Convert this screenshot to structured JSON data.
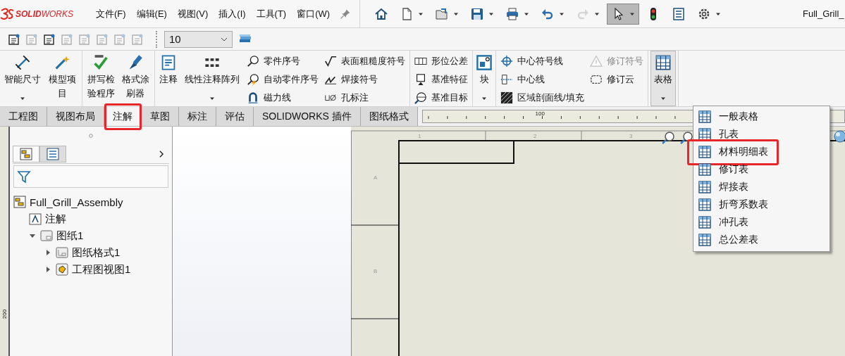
{
  "logo": {
    "text": "**SOLID**WORKS"
  },
  "menu_bar": [
    "文件(F)",
    "编辑(E)",
    "视图(V)",
    "插入(I)",
    "工具(T)",
    "窗口(W)"
  ],
  "quick_access": [
    {
      "has_dropdown": false,
      "disabled": false,
      "selected": false
    },
    {
      "has_dropdown": true,
      "disabled": false,
      "selected": false
    },
    {
      "has_dropdown": true,
      "disabled": false,
      "selected": false
    },
    {
      "has_dropdown": true,
      "disabled": false,
      "selected": false
    },
    {
      "has_dropdown": true,
      "disabled": false,
      "selected": false
    },
    {
      "has_dropdown": true,
      "disabled": false,
      "selected": false
    },
    {
      "has_dropdown": true,
      "disabled": true,
      "selected": false
    },
    {
      "has_dropdown": true,
      "disabled": false,
      "selected": true
    },
    {
      "has_dropdown": false,
      "disabled": false,
      "selected": false
    },
    {
      "has_dropdown": false,
      "disabled": false,
      "selected": false
    },
    {
      "has_dropdown": true,
      "disabled": false,
      "selected": false
    }
  ],
  "document_title": "Full_Grill_",
  "format_toolbar": {
    "tools": [
      {
        "disabled": false
      },
      {
        "disabled": true
      },
      {
        "disabled": false
      },
      {
        "disabled": true
      },
      {
        "disabled": true
      },
      {
        "disabled": true
      },
      {
        "disabled": true
      },
      {
        "disabled": true
      }
    ],
    "font_size": "10"
  },
  "ribbon": {
    "groups": [
      {
        "items": [
          {
            "kind": "large",
            "label": "智能尺寸",
            "has_dropdown": true,
            "selected": false
          },
          {
            "kind": "large",
            "label": "模型项目",
            "has_dropdown": false,
            "selected": false
          }
        ]
      },
      {
        "items": [
          {
            "kind": "large",
            "label": "拼写检验程序",
            "has_dropdown": false,
            "selected": false
          },
          {
            "kind": "large",
            "label": "格式涂刷器",
            "has_dropdown": false,
            "selected": false
          }
        ]
      },
      {
        "items": [
          {
            "kind": "large",
            "label": "注释",
            "has_dropdown": false,
            "selected": false
          },
          {
            "kind": "large",
            "label": "线性注释阵列",
            "has_dropdown": true,
            "selected": false
          },
          {
            "kind": "column",
            "entries": [
              {
                "label": "零件序号",
                "disabled": false
              },
              {
                "label": "自动零件序号",
                "disabled": false
              },
              {
                "label": "磁力线",
                "disabled": false
              }
            ]
          },
          {
            "kind": "column",
            "entries": [
              {
                "label": "表面粗糙度符号",
                "disabled": false
              },
              {
                "label": "焊接符号",
                "disabled": false
              },
              {
                "label": "孔标注",
                "disabled": false
              }
            ]
          }
        ]
      },
      {
        "items": [
          {
            "kind": "column",
            "entries": [
              {
                "label": "形位公差",
                "disabled": false
              },
              {
                "label": "基准特征",
                "disabled": false
              },
              {
                "label": "基准目标",
                "disabled": false
              }
            ]
          }
        ]
      },
      {
        "items": [
          {
            "kind": "large",
            "label": "块",
            "has_dropdown": true,
            "selected": false
          }
        ]
      },
      {
        "items": [
          {
            "kind": "column",
            "entries": [
              {
                "label": "中心符号线",
                "disabled": false
              },
              {
                "label": "中心线",
                "disabled": false
              },
              {
                "label": "区域剖面线/填充",
                "disabled": false
              }
            ]
          },
          {
            "kind": "column",
            "entries": [
              {
                "label": "修订符号",
                "disabled": true
              },
              {
                "label": "修订云",
                "disabled": false
              }
            ]
          }
        ]
      },
      {
        "items": [
          {
            "kind": "large",
            "label": "表格",
            "has_dropdown": true,
            "selected": true
          }
        ]
      }
    ]
  },
  "tabs": [
    {
      "label": "工程图",
      "selected": false,
      "highlighted": false
    },
    {
      "label": "视图布局",
      "selected": false,
      "highlighted": false
    },
    {
      "label": "注解",
      "selected": true,
      "highlighted": true
    },
    {
      "label": "草图",
      "selected": false,
      "highlighted": false
    },
    {
      "label": "标注",
      "selected": false,
      "highlighted": false
    },
    {
      "label": "评估",
      "selected": false,
      "highlighted": false
    },
    {
      "label": "SOLIDWORKS 插件",
      "selected": false,
      "highlighted": false
    },
    {
      "label": "图纸格式",
      "selected": false,
      "highlighted": false
    }
  ],
  "ruler": {
    "label": "100"
  },
  "side_ruler": {
    "label": "200"
  },
  "feature_manager": {
    "panel_tabs": [
      {
        "selected": true
      },
      {
        "selected": false
      }
    ],
    "tree": [
      {
        "label": "Full_Grill_Assembly",
        "children": [
          {
            "label": "注解"
          },
          {
            "label": "图纸1",
            "expanded": true,
            "children": [
              {
                "label": "图纸格式1",
                "expanded": false
              },
              {
                "label": "工程图视图1",
                "expanded": false
              }
            ]
          }
        ]
      }
    ]
  },
  "sheet": {
    "column_zones": [
      "1",
      "2",
      "3"
    ],
    "row_zones": [
      "A",
      "B"
    ]
  },
  "table_menu": {
    "items": [
      {
        "label": "一般表格",
        "highlighted": false
      },
      {
        "label": "孔表",
        "highlighted": false
      },
      {
        "label": "材料明细表",
        "highlighted": true
      },
      {
        "label": "修订表",
        "highlighted": false
      },
      {
        "label": "焊接表",
        "highlighted": false
      },
      {
        "label": "折弯系数表",
        "highlighted": false
      },
      {
        "label": "冲孔表",
        "highlighted": false
      },
      {
        "label": "总公差表",
        "highlighted": false
      }
    ]
  }
}
